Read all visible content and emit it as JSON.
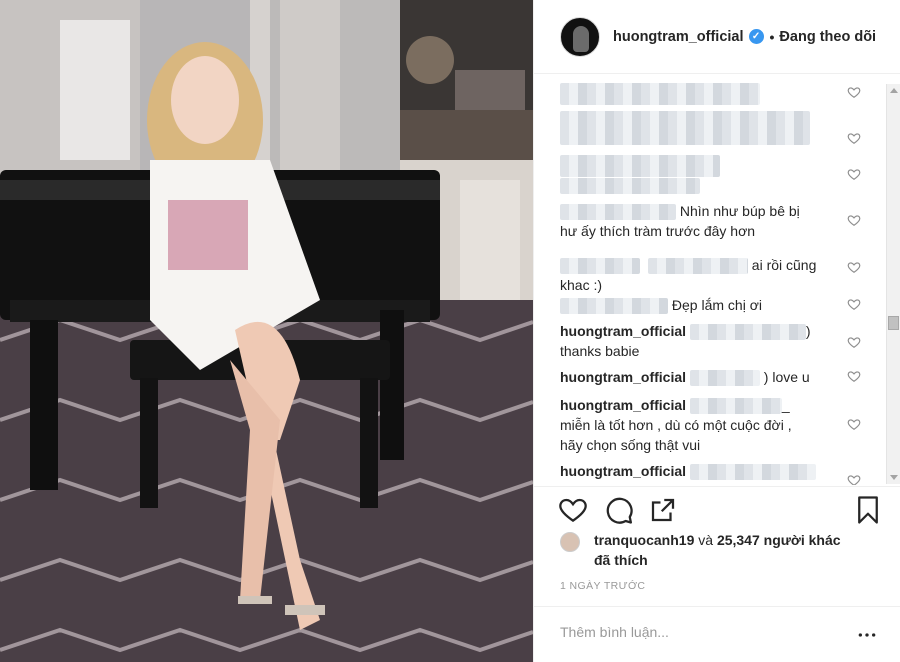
{
  "post": {
    "username": "huongtram_official",
    "separator": "•",
    "follow_status": "Đang theo dõi",
    "verified_mark": "✓"
  },
  "comments": [
    {
      "text": "Nhìn như búp bê bị",
      "text2": "hư ấy thích tràm trước đây hơn"
    },
    {
      "text": "ai rồi cũng",
      "text2": "khac :)"
    },
    {
      "text": "Đẹp lắm chị ơi"
    },
    {
      "username": "huongtram_official",
      "suffix": ")",
      "text2": "thanks babie"
    },
    {
      "username": "huongtram_official",
      "text": ") love u"
    },
    {
      "username": "huongtram_official",
      "suffix": "_",
      "text2": "miễn là tốt hơn , dù có một cuộc đời ,",
      "text3": "hãy chọn sống thật vui"
    },
    {
      "username": "huongtram_official"
    }
  ],
  "likes": {
    "user": "tranquocanh19",
    "joiner": " và ",
    "count": "25,347",
    "rest": " người khác",
    "line2": "đã thích"
  },
  "timestamp": "1 NGÀY TRƯỚC",
  "add_comment": {
    "placeholder": "Thêm bình luận..."
  },
  "icons": [
    "heart-icon",
    "comment-icon",
    "share-icon",
    "bookmark-icon",
    "more-icon"
  ],
  "colors": {
    "verified": "#3897f0",
    "text": "#262626",
    "muted": "#999999",
    "border": "#efefef"
  }
}
